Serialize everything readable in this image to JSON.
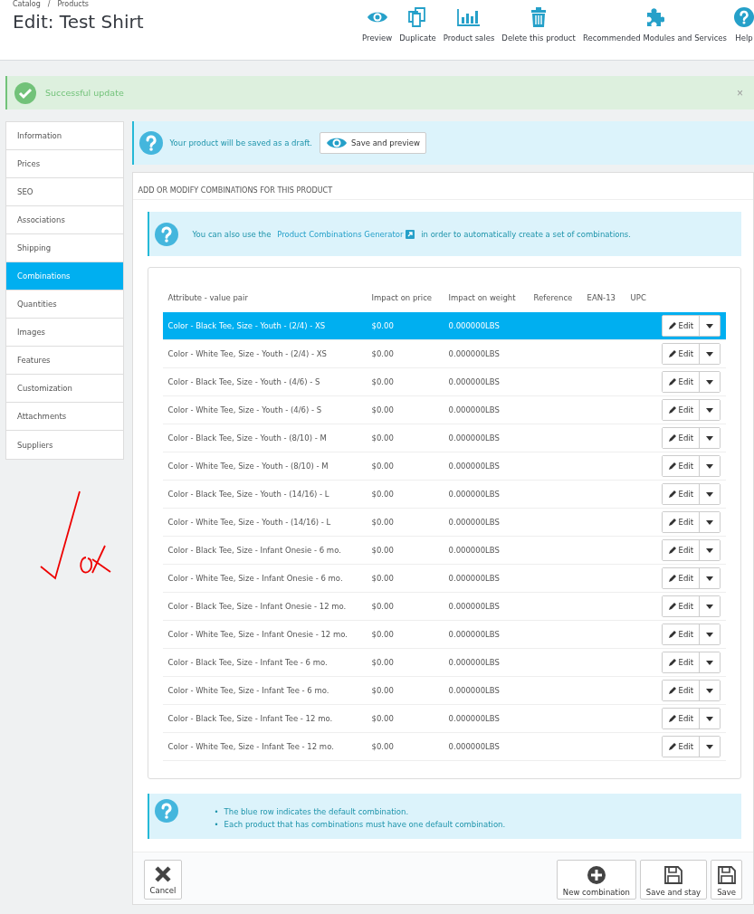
{
  "breadcrumb": [
    "Catalog",
    "/",
    "Products"
  ],
  "title": "Edit: Test Shirt",
  "toolbar": [
    {
      "kind": "eye",
      "label": "Preview"
    },
    {
      "kind": "copy",
      "label": "Duplicate"
    },
    {
      "kind": "chart",
      "label": "Product sales"
    },
    {
      "kind": "trash",
      "label": "Delete this product"
    },
    {
      "kind": "puzzle",
      "label": "Recommended Modules and Services"
    },
    {
      "kind": "help",
      "label": "Help"
    }
  ],
  "alert": {
    "text": "Successful update",
    "close": "×"
  },
  "sidebar": [
    {
      "label": "Information",
      "selected": false
    },
    {
      "label": "Prices",
      "selected": false
    },
    {
      "label": "SEO",
      "selected": false
    },
    {
      "label": "Associations",
      "selected": false
    },
    {
      "label": "Shipping",
      "selected": false
    },
    {
      "label": "Combinations",
      "selected": true
    },
    {
      "label": "Quantities",
      "selected": false
    },
    {
      "label": "Images",
      "selected": false
    },
    {
      "label": "Features",
      "selected": false
    },
    {
      "label": "Customization",
      "selected": false
    },
    {
      "label": "Attachments",
      "selected": false
    },
    {
      "label": "Suppliers",
      "selected": false
    }
  ],
  "draft_notice": {
    "text": "Your product will be saved as a draft.",
    "button": "Save and preview"
  },
  "panel": {
    "heading": "ADD OR MODIFY COMBINATIONS FOR THIS PRODUCT",
    "generator_notice": {
      "before": "You can also use the",
      "link": "Product Combinations Generator",
      "after": "in order to automatically create a set of combinations."
    },
    "table": {
      "columns": [
        "Attribute - value pair",
        "Impact on price",
        "Impact on weight",
        "Reference",
        "EAN-13",
        "UPC"
      ],
      "rows": [
        {
          "attribute": "Color - Black Tee, Size - Youth - (2/4) - XS",
          "price": "$0.00",
          "weight": "0.000000LBS",
          "selected": true
        },
        {
          "attribute": "Color - White Tee, Size - Youth - (2/4) - XS",
          "price": "$0.00",
          "weight": "0.000000LBS",
          "selected": false
        },
        {
          "attribute": "Color - Black Tee, Size - Youth - (4/6) - S",
          "price": "$0.00",
          "weight": "0.000000LBS",
          "selected": false
        },
        {
          "attribute": "Color - White Tee, Size - Youth - (4/6) - S",
          "price": "$0.00",
          "weight": "0.000000LBS",
          "selected": false
        },
        {
          "attribute": "Color - Black Tee, Size - Youth - (8/10) - M",
          "price": "$0.00",
          "weight": "0.000000LBS",
          "selected": false
        },
        {
          "attribute": "Color - White Tee, Size - Youth - (8/10) - M",
          "price": "$0.00",
          "weight": "0.000000LBS",
          "selected": false
        },
        {
          "attribute": "Color - Black Tee, Size - Youth - (14/16) - L",
          "price": "$0.00",
          "weight": "0.000000LBS",
          "selected": false
        },
        {
          "attribute": "Color - White Tee, Size - Youth - (14/16) - L",
          "price": "$0.00",
          "weight": "0.000000LBS",
          "selected": false
        },
        {
          "attribute": "Color - Black Tee, Size - Infant Onesie - 6 mo.",
          "price": "$0.00",
          "weight": "0.000000LBS",
          "selected": false
        },
        {
          "attribute": "Color - White Tee, Size - Infant Onesie - 6 mo.",
          "price": "$0.00",
          "weight": "0.000000LBS",
          "selected": false
        },
        {
          "attribute": "Color - Black Tee, Size - Infant Onesie - 12 mo.",
          "price": "$0.00",
          "weight": "0.000000LBS",
          "selected": false
        },
        {
          "attribute": "Color - White Tee, Size - Infant Onesie - 12 mo.",
          "price": "$0.00",
          "weight": "0.000000LBS",
          "selected": false
        },
        {
          "attribute": "Color - Black Tee, Size - Infant Tee - 6 mo.",
          "price": "$0.00",
          "weight": "0.000000LBS",
          "selected": false
        },
        {
          "attribute": "Color - White Tee, Size - Infant Tee - 6 mo.",
          "price": "$0.00",
          "weight": "0.000000LBS",
          "selected": false
        },
        {
          "attribute": "Color - Black Tee, Size - Infant Tee - 12 mo.",
          "price": "$0.00",
          "weight": "0.000000LBS",
          "selected": false
        },
        {
          "attribute": "Color - White Tee, Size - Infant Tee - 12 mo.",
          "price": "$0.00",
          "weight": "0.000000LBS",
          "selected": false
        }
      ],
      "edit_labels": [
        "Edit",
        "Edit",
        "Edit",
        "Edit",
        "Edit",
        "Edit",
        "Edit",
        "Edit",
        "Edit",
        "Edit",
        "Edit",
        "Edit",
        "Edit",
        "Edit",
        "Edit",
        "Edit"
      ]
    },
    "hints": [
      {
        "bullet": "•",
        "text": "The blue row indicates the default combination."
      },
      {
        "bullet": "•",
        "text": "Each product that has combinations must have one default combination."
      }
    ],
    "footer": [
      {
        "kind": "cancel",
        "label": "Cancel"
      },
      {
        "kind": "plus",
        "label": "New combination"
      },
      {
        "kind": "save",
        "label": "Save and stay"
      },
      {
        "kind": "save",
        "label": "Save"
      }
    ]
  }
}
